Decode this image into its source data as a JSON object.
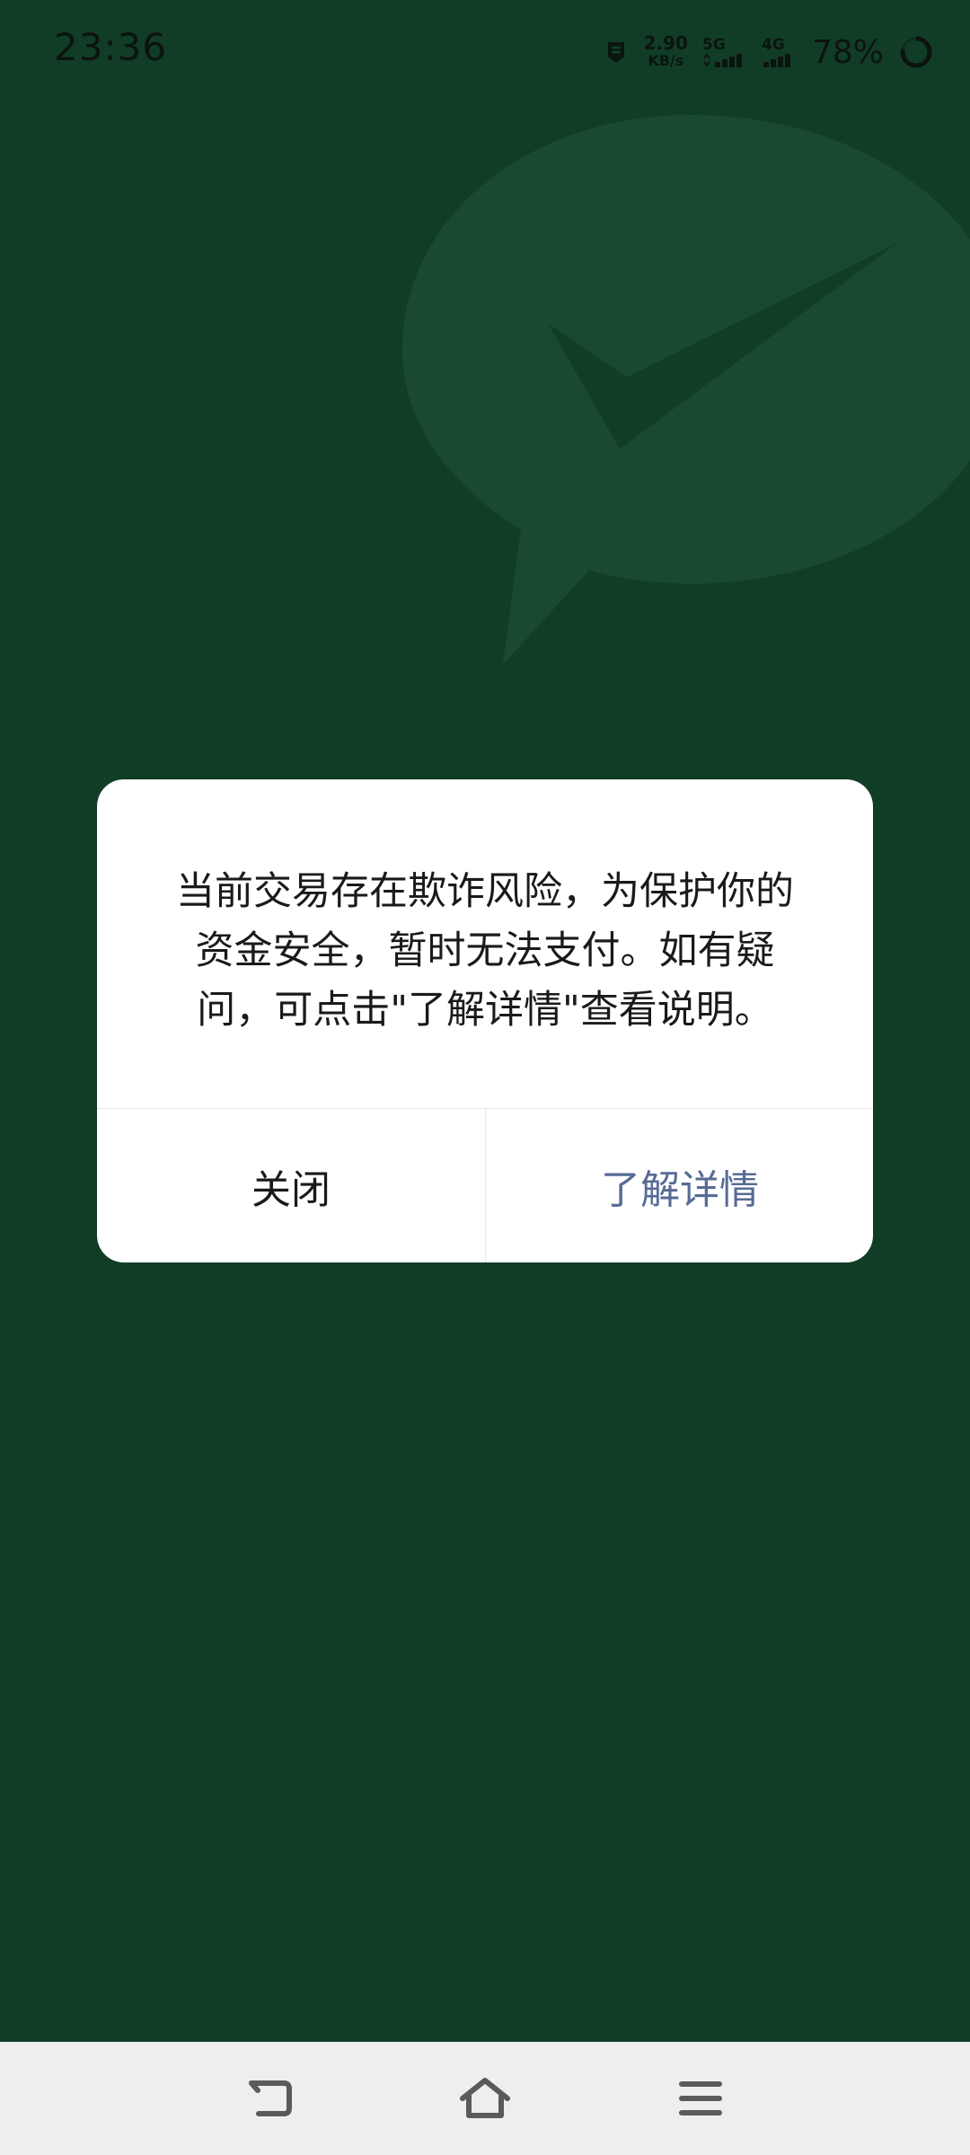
{
  "status_bar": {
    "time": "23:36",
    "net_speed_value": "2.90",
    "net_speed_unit": "KB/s",
    "sim1_label": "5G",
    "sim2_label": "4G",
    "battery": "78%"
  },
  "dialog": {
    "message_line1": "当前交易存在欺诈风险，为保护你的",
    "message_line2": "资金安全，暂时无法支付。如有疑",
    "message_line3": "问，可点击\"了解详情\"查看说明。",
    "close_label": "关闭",
    "details_label": "了解详情"
  },
  "colors": {
    "background": "#113d27",
    "link": "#576b95",
    "nav_bar": "#eeeeee"
  },
  "icons": {
    "back": "back-icon",
    "home": "home-icon",
    "menu": "menu-icon",
    "notification": "notification-icon",
    "battery": "battery-ring-icon",
    "logo": "wechat-pay-logo-icon"
  }
}
